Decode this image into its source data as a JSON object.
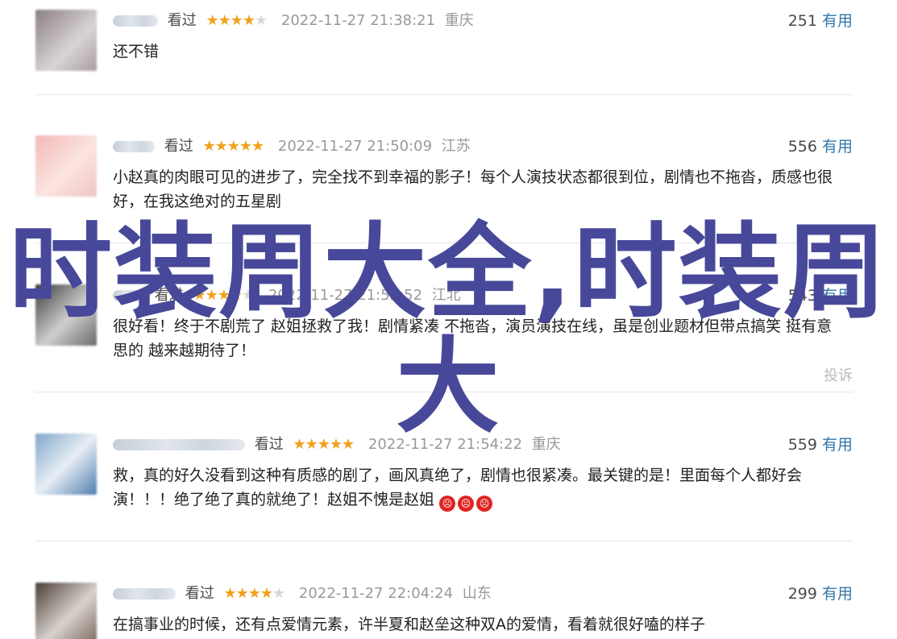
{
  "comments": [
    {
      "status": "看过",
      "rating": 4,
      "time": "2022-11-27 21:38:21",
      "location": "重庆",
      "votes": "251",
      "useful_label": "有用",
      "text": "还不错",
      "avatar_colors": [
        "#8a7f86",
        "#d9d3d6"
      ]
    },
    {
      "status": "看过",
      "rating": 5,
      "time": "2022-11-27 21:50:09",
      "location": "江苏",
      "votes": "556",
      "useful_label": "有用",
      "text": "小赵真的肉眼可见的进步了，完全找不到幸福的影子！每个人演技状态都很到位，剧情也不拖沓，质感也很好，在我这绝对的五星剧",
      "avatar_colors": [
        "#f2b8b8",
        "#fbe5e0"
      ]
    },
    {
      "status": "看过",
      "rating": 4,
      "time": "2022-11-27 21:53:52",
      "location": "江北",
      "votes": "543",
      "useful_label": "有用",
      "text": "很好看！终于不剧荒了 赵姐拯救了我！剧情紧凑 不拖沓，演员演技在线，虽是创业题材但带点搞笑 挺有意思的 越来越期待了！",
      "report_label": "投诉",
      "avatar_colors": [
        "#3a3a3a",
        "#cfcfcf"
      ]
    },
    {
      "status": "看过",
      "rating": 5,
      "time": "2022-11-27 21:54:22",
      "location": "重庆",
      "votes": "559",
      "useful_label": "有用",
      "text": "救，真的好久没看到这种有质感的剧了，画风真绝了，剧情也很紧凑。最关键的是！里面每个人都好会演！！！绝了绝了真的就绝了！赵姐不愧是赵姐",
      "emoji_count": 3,
      "avatar_colors": [
        "#7fa6c9",
        "#e8eef5"
      ]
    },
    {
      "status": "看过",
      "rating": 4,
      "time": "2022-11-27 22:04:24",
      "location": "山东",
      "votes": "299",
      "useful_label": "有用",
      "text": "在搞事业的时候，还有点爱情元素，许半夏和赵垒这种双A的爱情，看着就很好嗑的样子",
      "avatar_colors": [
        "#4a3d35",
        "#d8d2cd"
      ]
    }
  ],
  "overlay_title": "时装周大全,时装周大"
}
